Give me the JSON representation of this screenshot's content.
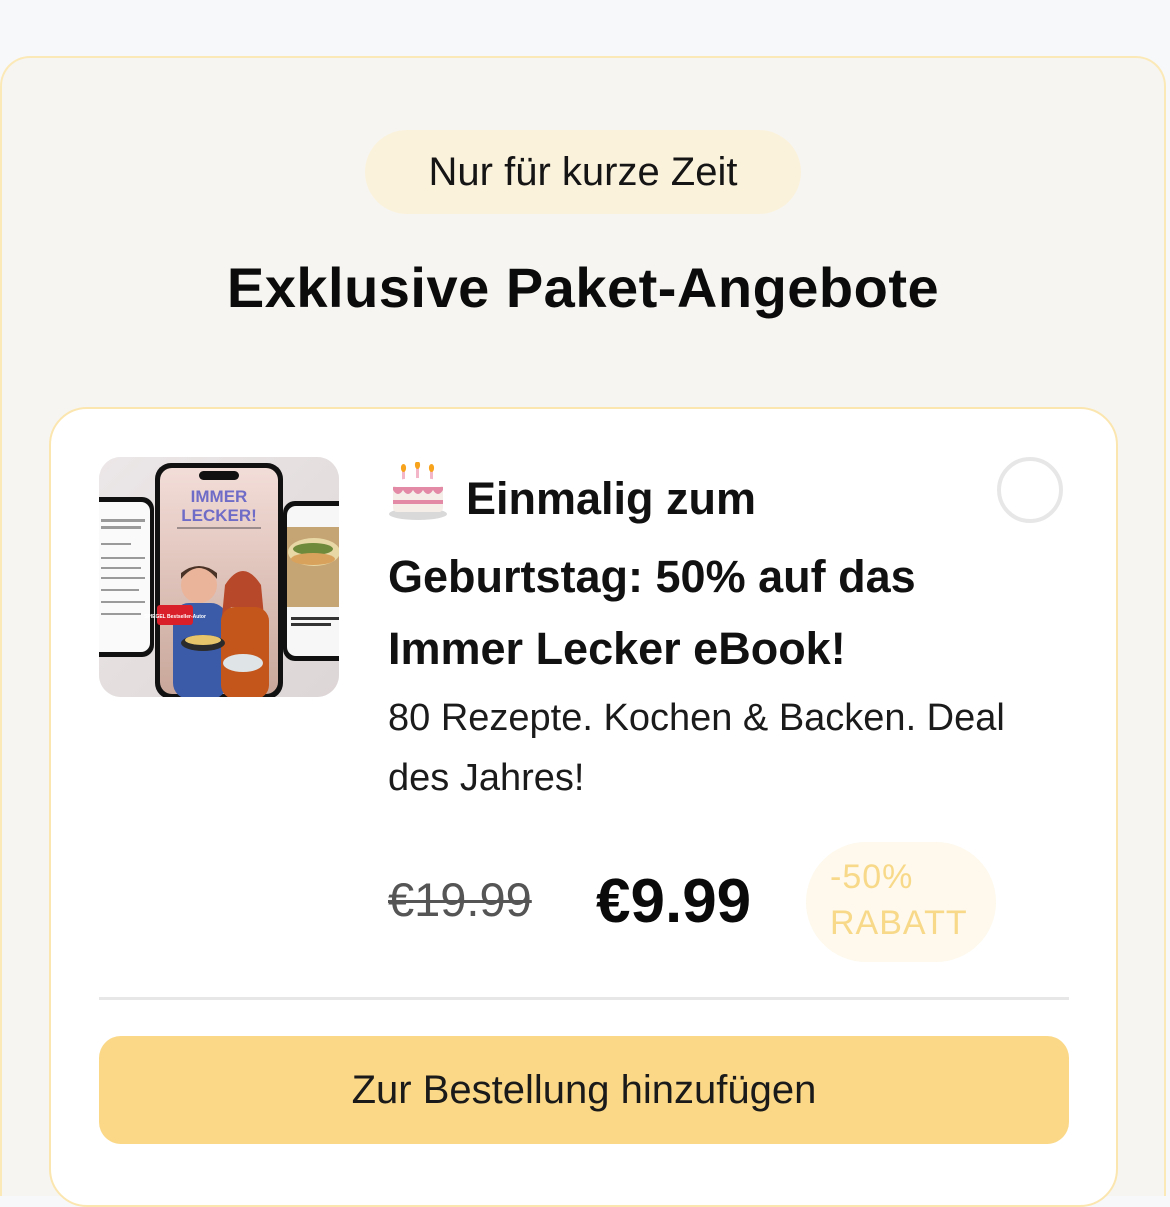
{
  "banner": {
    "pill_label": "Nur für kurze Zeit",
    "title": "Exklusive Paket-Angebote"
  },
  "offer": {
    "image_icon": "ebook-product-image",
    "emoji": "birthday-cake-icon",
    "title": "Einmalig zum Geburtstag: 50% auf das Immer Lecker eBook!",
    "description": "80 Rezepte. Kochen & Backen. Deal des Jahres!",
    "selected": false,
    "price_old": "€19.99",
    "price_new": "€9.99",
    "discount_line1": "-50%",
    "discount_line2": "RABATT",
    "cta_label": "Zur Bestellung hinzufügen",
    "ebook_cover": {
      "title_line1": "IMMER",
      "title_line2": "LECKER!",
      "stamp": "SPIEGEL Bestseller-Autor"
    }
  },
  "colors": {
    "accent": "#fad887",
    "pill_bg": "#fbf2dc",
    "badge_text": "#f8d98a",
    "card_border": "#fbe6b0"
  }
}
